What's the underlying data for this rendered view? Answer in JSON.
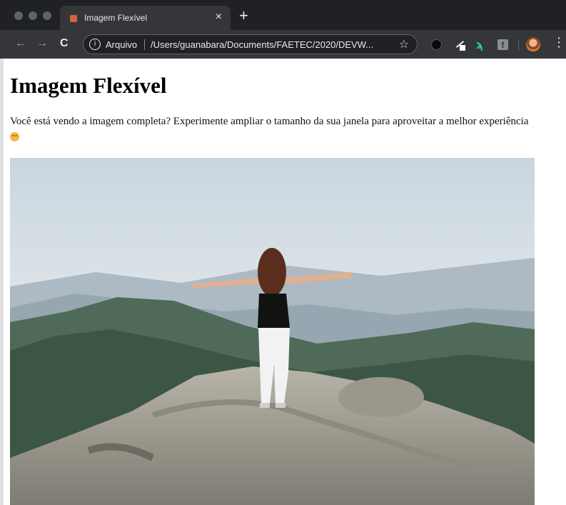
{
  "browser": {
    "tab": {
      "title": "Imagem Flexível",
      "close": "×"
    },
    "new_tab": "+",
    "nav": {
      "back": "←",
      "forward": "→",
      "reload": "C"
    },
    "omnibox": {
      "info_icon": "i",
      "scheme_label": "Arquivo",
      "url": "/Users/guanabara/Documents/FAETEC/2020/DEVW...",
      "star": "☆"
    },
    "extensions": [
      "vpn-shield-icon",
      "pen-extension-icon",
      "green-extension-icon",
      "facebook-icon"
    ],
    "facebook_glyph": "f",
    "menu": "⋮"
  },
  "page": {
    "heading": "Imagem Flexível",
    "intro": "Você está vendo a imagem completa? Experimente ampliar o tamanho da sua janela para aproveitar a melhor experiência",
    "hero_image": "woman-arms-open-on-mountain-summit"
  },
  "colors": {
    "tab_strip": "#202124",
    "toolbar": "#35363a",
    "page_bg": "#ffffff"
  }
}
